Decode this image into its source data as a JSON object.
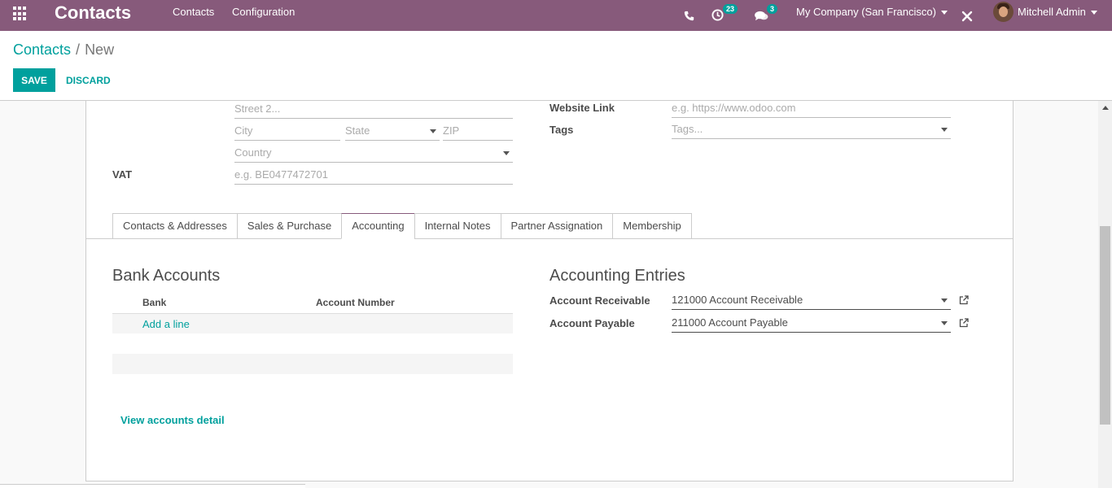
{
  "navbar": {
    "app_title": "Contacts",
    "menu": [
      "Contacts",
      "Configuration"
    ],
    "activity_count": "23",
    "messages_count": "3",
    "company": "My Company (San Francisco)",
    "user": "Mitchell Admin"
  },
  "breadcrumb": {
    "parent": "Contacts",
    "separator": "/",
    "current": "New"
  },
  "buttons": {
    "save": "SAVE",
    "discard": "DISCARD"
  },
  "address": {
    "street2_placeholder": "Street 2...",
    "city_placeholder": "City",
    "state_placeholder": "State",
    "zip_placeholder": "ZIP",
    "country_placeholder": "Country"
  },
  "vat": {
    "label": "VAT",
    "placeholder": "e.g. BE0477472701"
  },
  "website": {
    "label": "Website Link",
    "placeholder": "e.g. https://www.odoo.com"
  },
  "tags": {
    "label": "Tags",
    "placeholder": "Tags..."
  },
  "tabs": [
    "Contacts & Addresses",
    "Sales & Purchase",
    "Accounting",
    "Internal Notes",
    "Partner Assignation",
    "Membership"
  ],
  "active_tab": "Accounting",
  "bank_accounts": {
    "title": "Bank Accounts",
    "col_bank": "Bank",
    "col_account_number": "Account Number",
    "add_line": "Add a line",
    "view_detail": "View accounts detail"
  },
  "accounting_entries": {
    "title": "Accounting Entries",
    "receivable_label": "Account Receivable",
    "receivable_value": "121000 Account Receivable",
    "payable_label": "Account Payable",
    "payable_value": "211000 Account Payable"
  },
  "colors": {
    "brand": "#875a7b",
    "accent": "#00a09d"
  }
}
